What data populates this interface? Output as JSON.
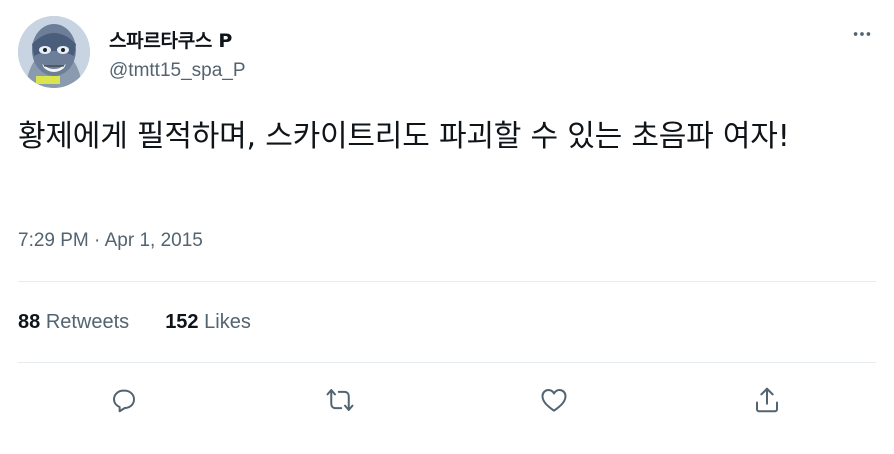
{
  "user": {
    "display_name": "스파르타쿠스 P",
    "handle": "@tmtt15_spa_P"
  },
  "tweet": {
    "text": "황제에게 필적하며, 스카이트리도 파괴할 수 있는 초음파 여자!",
    "timestamp": "7:29 PM · Apr 1, 2015"
  },
  "stats": {
    "retweets_count": "88",
    "retweets_label": "Retweets",
    "likes_count": "152",
    "likes_label": "Likes"
  },
  "icons": {
    "more": "more-horizontal-icon",
    "reply": "reply-icon",
    "retweet": "retweet-icon",
    "like": "like-icon",
    "share": "share-icon"
  },
  "colors": {
    "text": "#0f1419",
    "secondary": "#536471",
    "divider": "#e6ecf0"
  }
}
